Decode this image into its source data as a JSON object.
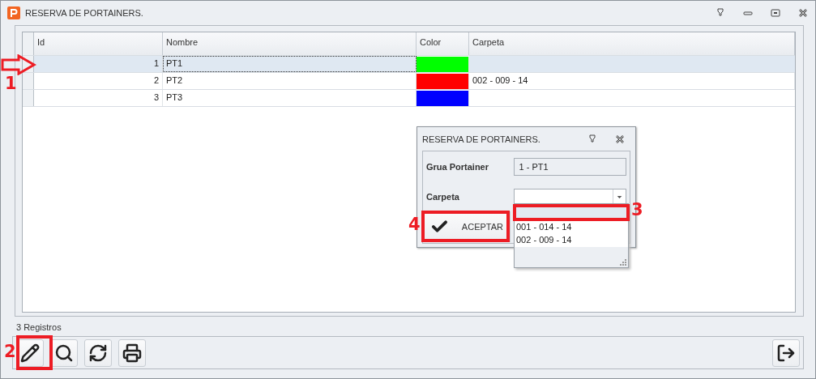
{
  "window": {
    "title": "RESERVA DE PORTAINERS."
  },
  "grid": {
    "columns": [
      "Id",
      "Nombre",
      "Color",
      "Carpeta"
    ],
    "rows": [
      {
        "id": "1",
        "nombre": "PT1",
        "color": "#00ff00",
        "selected": true
      },
      {
        "id": "2",
        "nombre": "PT2",
        "color": "#ff0000",
        "carpeta": "002 - 009 - 14",
        "selected": false
      },
      {
        "id": "3",
        "nombre": "PT3",
        "color": "#0000ff",
        "selected": false
      }
    ]
  },
  "status": "3 Registros",
  "toolbar": [
    {
      "kind": "edit"
    },
    {
      "kind": "search"
    },
    {
      "kind": "refresh"
    },
    {
      "kind": "print"
    }
  ],
  "exit_button": {
    "kind": "exit"
  },
  "dialog": {
    "title": "RESERVA DE PORTAINERS.",
    "fields": [
      {
        "kind": "text",
        "label": "Grua Portainer",
        "value": "1 - PT1"
      },
      {
        "kind": "combo",
        "label": "Carpeta"
      }
    ],
    "accept_button": "ACEPTAR",
    "dropdown": [
      {
        "selected": true
      },
      {
        "label": "001 - 014 - 14",
        "selected": false
      },
      {
        "label": "002 - 009 - 14",
        "selected": false
      }
    ]
  },
  "annotations": [
    {
      "kind": "arrow",
      "label": "1"
    },
    {
      "kind": "frame",
      "label": "2"
    },
    {
      "kind": "frame",
      "label": "3"
    },
    {
      "kind": "frame",
      "label": "4"
    }
  ]
}
